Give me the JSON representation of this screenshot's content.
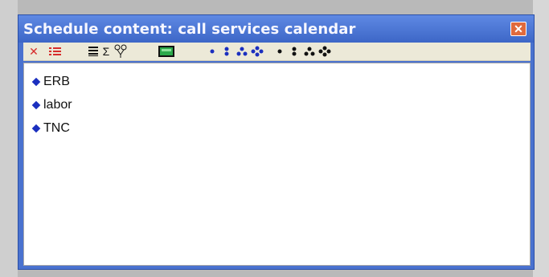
{
  "window": {
    "title": "Schedule content:  call services calendar"
  },
  "toolbar": {
    "icons": [
      "delete-icon",
      "list-red-icon",
      "list-lines-icon",
      "sum-icon",
      "tree-icon",
      "calendar-icon",
      "blue-bullet-1-icon",
      "blue-bullet-2-icon",
      "blue-bullet-3-icon",
      "blue-bullet-4-icon",
      "black-bullet-1-icon",
      "black-bullet-2-icon",
      "black-bullet-3-icon",
      "black-bullet-4-icon"
    ]
  },
  "items": [
    {
      "label": "ERB"
    },
    {
      "label": "labor"
    },
    {
      "label": "TNC"
    }
  ],
  "colors": {
    "titlebar": "#4a72cf",
    "bullet_blue": "#1b2fbf",
    "toolbar_bg": "#ece9d8",
    "close": "#e06a3d"
  }
}
